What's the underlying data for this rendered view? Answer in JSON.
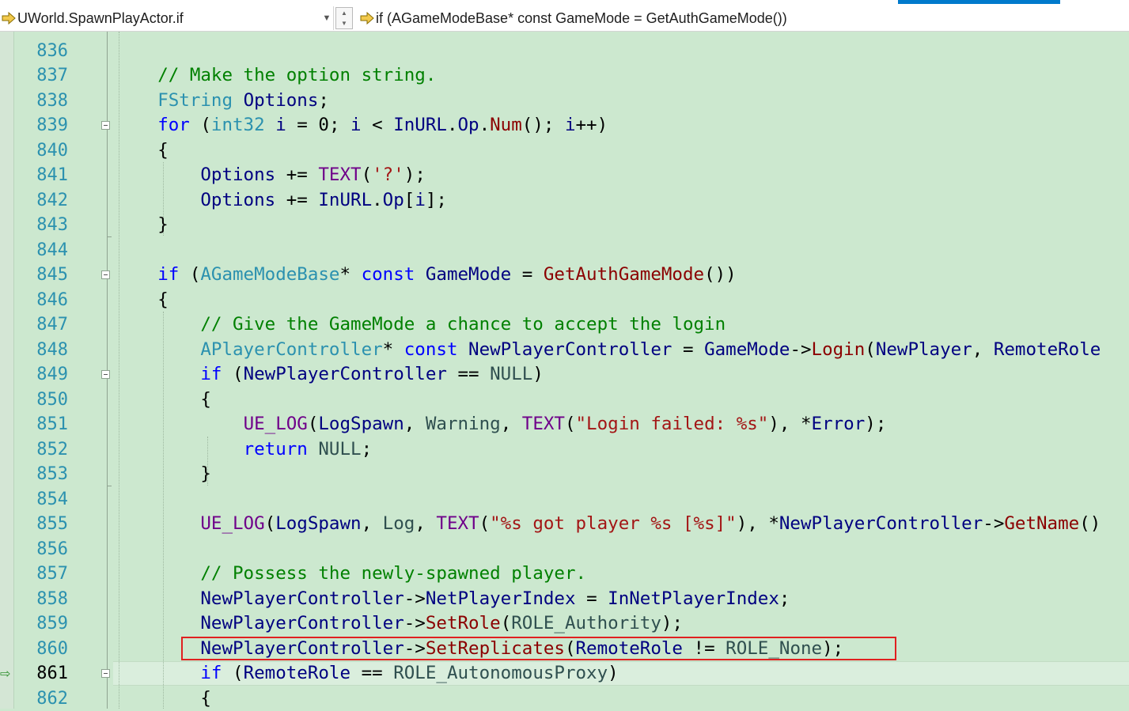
{
  "navbar": {
    "scope": "UWorld.SpawnPlayActor.if",
    "member": "if (AGameModeBase* const GameMode = GetAuthGameMode())"
  },
  "editor": {
    "lines": [
      {
        "n": "836",
        "code": ""
      },
      {
        "n": "837",
        "code": "    // Make the option string."
      },
      {
        "n": "838",
        "code": "    FString Options;"
      },
      {
        "n": "839",
        "code": "    for (int32 i = 0; i < InURL.Op.Num(); i++)"
      },
      {
        "n": "840",
        "code": "    {"
      },
      {
        "n": "841",
        "code": "        Options += TEXT('?');"
      },
      {
        "n": "842",
        "code": "        Options += InURL.Op[i];"
      },
      {
        "n": "843",
        "code": "    }"
      },
      {
        "n": "844",
        "code": ""
      },
      {
        "n": "845",
        "code": "    if (AGameModeBase* const GameMode = GetAuthGameMode())"
      },
      {
        "n": "846",
        "code": "    {"
      },
      {
        "n": "847",
        "code": "        // Give the GameMode a chance to accept the login"
      },
      {
        "n": "848",
        "code": "        APlayerController* const NewPlayerController = GameMode->Login(NewPlayer, RemoteRole"
      },
      {
        "n": "849",
        "code": "        if (NewPlayerController == NULL)"
      },
      {
        "n": "850",
        "code": "        {"
      },
      {
        "n": "851",
        "code": "            UE_LOG(LogSpawn, Warning, TEXT(\"Login failed: %s\"), *Error);"
      },
      {
        "n": "852",
        "code": "            return NULL;"
      },
      {
        "n": "853",
        "code": "        }"
      },
      {
        "n": "854",
        "code": ""
      },
      {
        "n": "855",
        "code": "        UE_LOG(LogSpawn, Log, TEXT(\"%s got player %s [%s]\"), *NewPlayerController->GetName()"
      },
      {
        "n": "856",
        "code": ""
      },
      {
        "n": "857",
        "code": "        // Possess the newly-spawned player."
      },
      {
        "n": "858",
        "code": "        NewPlayerController->NetPlayerIndex = InNetPlayerIndex;"
      },
      {
        "n": "859",
        "code": "        NewPlayerController->SetRole(ROLE_Authority);"
      },
      {
        "n": "860",
        "code": "        NewPlayerController->SetReplicates(RemoteRole != ROLE_None);"
      },
      {
        "n": "861",
        "code": "        if (RemoteRole == ROLE_AutonomousProxy)"
      },
      {
        "n": "862",
        "code": "        {"
      }
    ],
    "current_line": "861",
    "highlighted_line": "860"
  }
}
